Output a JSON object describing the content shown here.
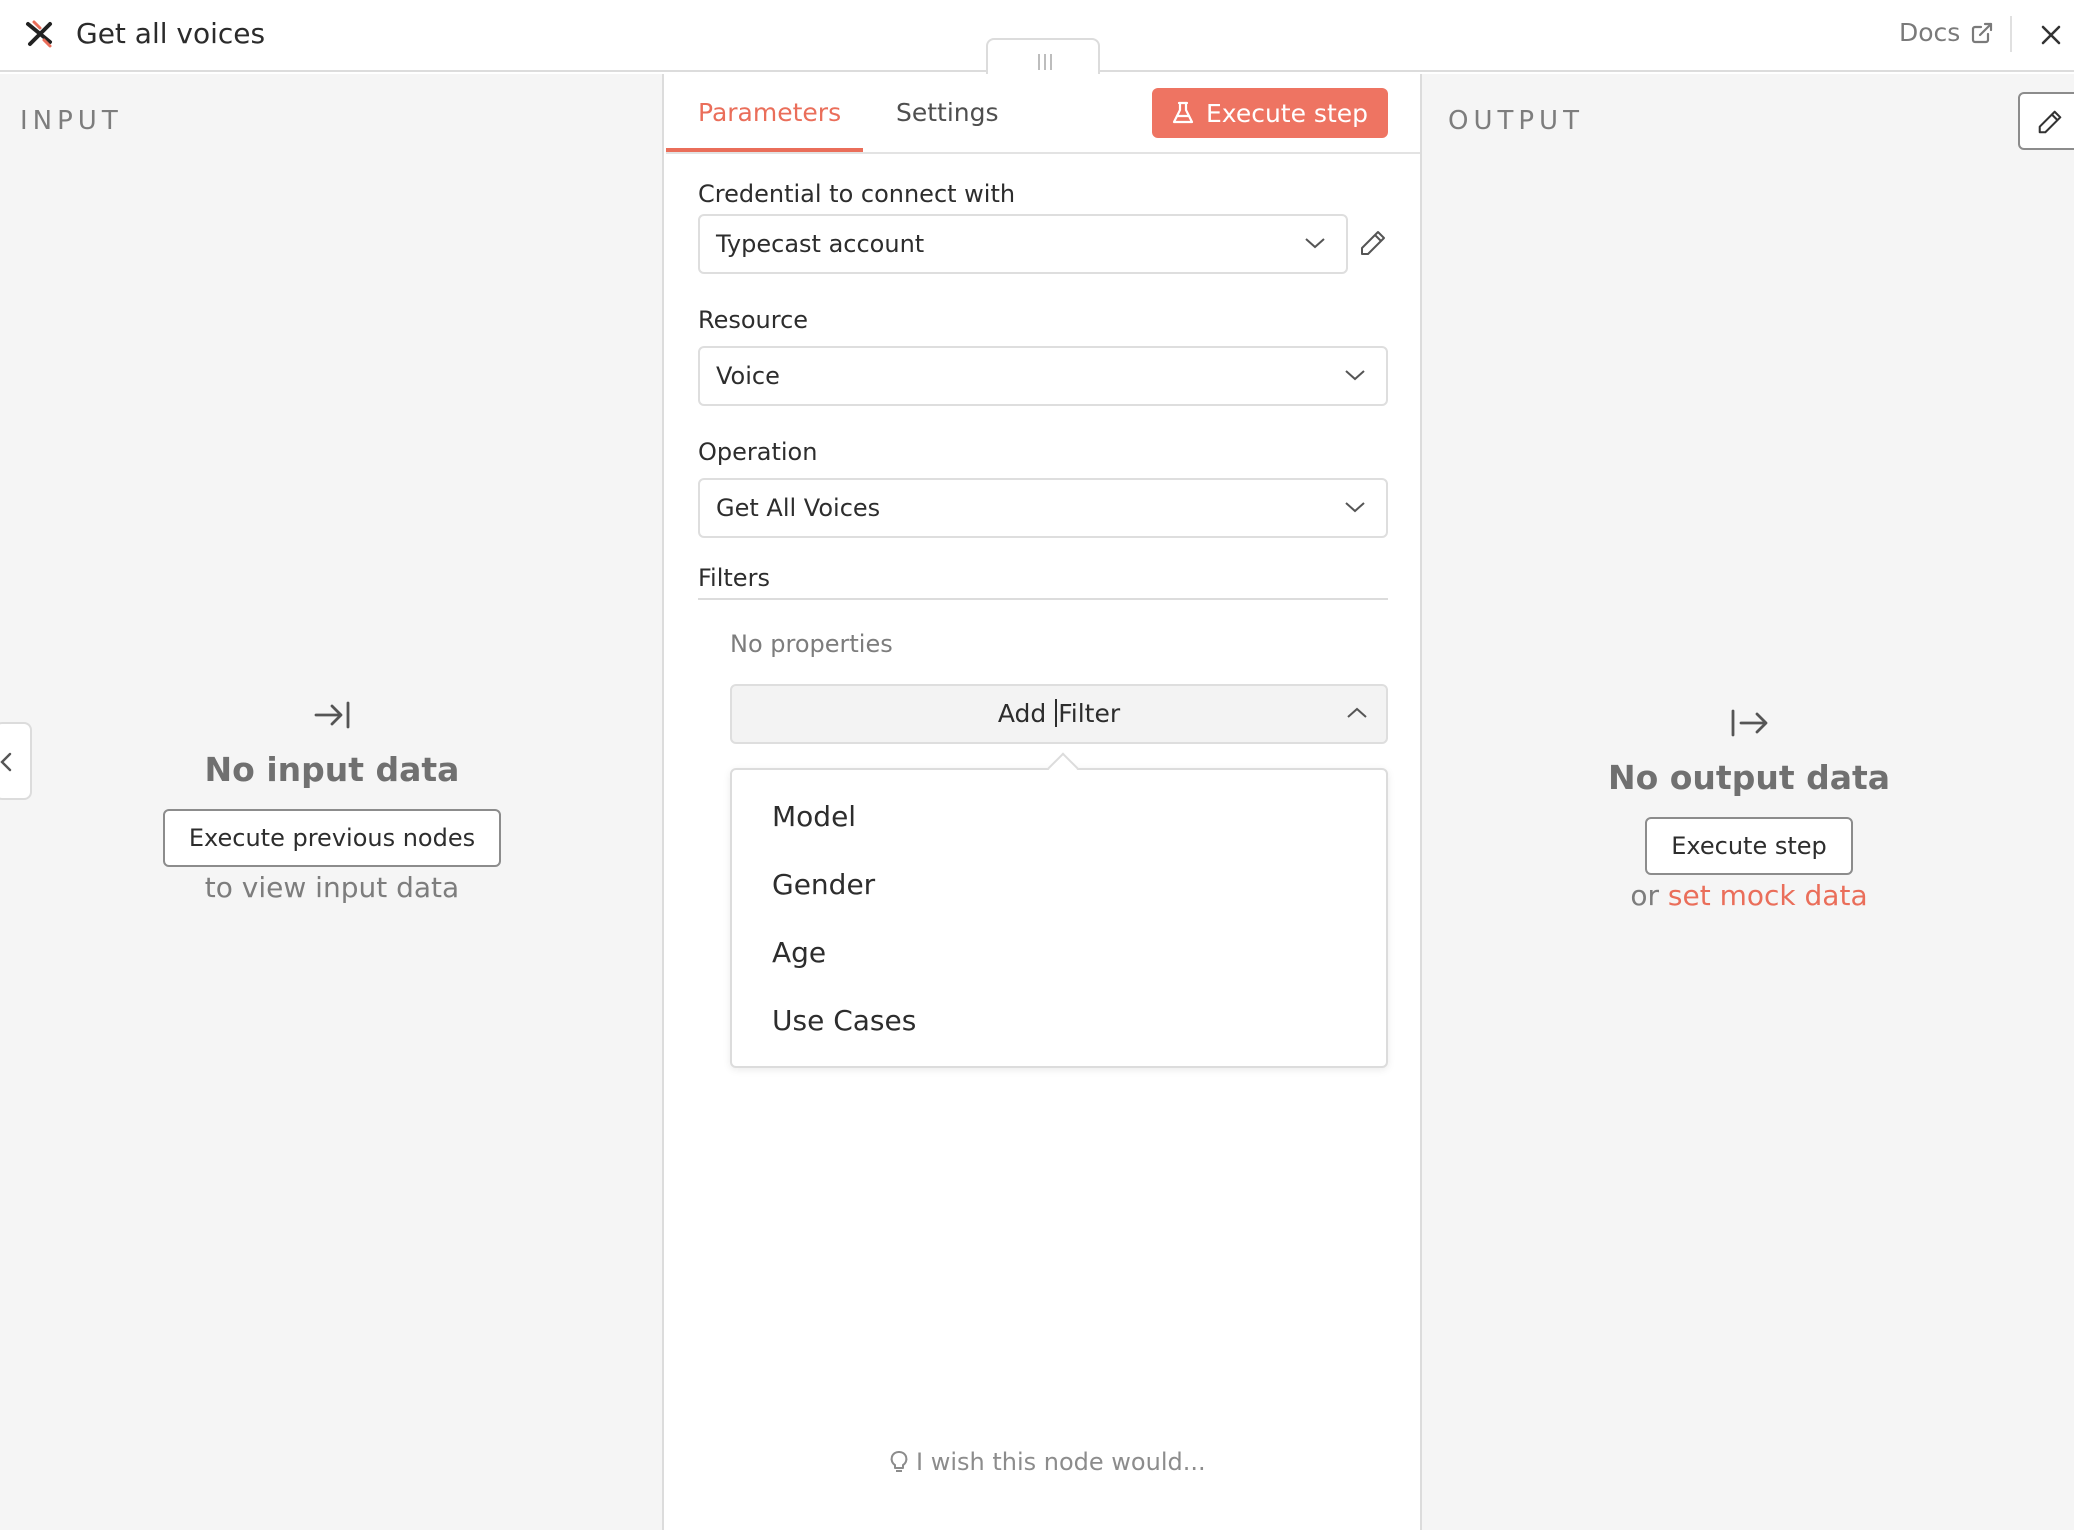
{
  "header": {
    "title": "Get all voices",
    "docs_label": "Docs"
  },
  "input": {
    "label": "INPUT",
    "empty_title": "No input data",
    "execute_button": "Execute previous nodes",
    "sub_text": "to view input data"
  },
  "parameters": {
    "tabs": [
      {
        "label": "Parameters",
        "active": true
      },
      {
        "label": "Settings",
        "active": false
      }
    ],
    "execute_button": "Execute step",
    "credential_label": "Credential to connect with",
    "credential_value": "Typecast account",
    "resource_label": "Resource",
    "resource_value": "Voice",
    "operation_label": "Operation",
    "operation_value": "Get All Voices",
    "filters_label": "Filters",
    "no_properties": "No properties",
    "add_filter_before": "Add ",
    "add_filter_after": "Filter",
    "filter_options": [
      "Model",
      "Gender",
      "Age",
      "Use Cases"
    ],
    "wish_text": "I wish this node would..."
  },
  "output": {
    "label": "OUTPUT",
    "empty_title": "No output data",
    "execute_button": "Execute step",
    "or_text": "or ",
    "mock_link": "set mock data"
  },
  "colors": {
    "accent": "#ea6e5a",
    "button_accent": "#ee7462",
    "pane_bg": "#f5f5f5"
  },
  "icons": {
    "logo": "n8n-node-logo-icon",
    "docs": "external-link-icon",
    "close": "close-icon",
    "execute": "flask-icon",
    "edit": "pencil-icon",
    "input_empty": "arrow-right-to-bar-icon",
    "output_empty": "arrow-right-from-bar-icon",
    "wish": "lightbulb-icon"
  }
}
